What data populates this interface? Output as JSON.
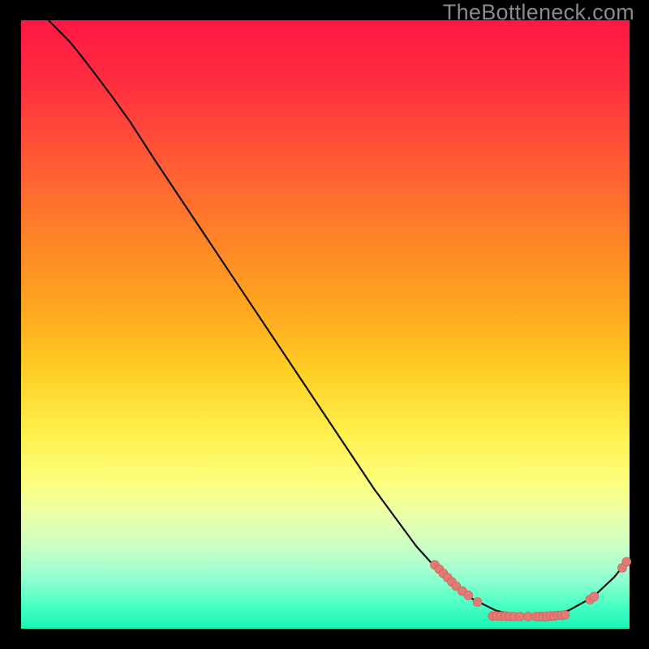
{
  "watermark": "TheBottleneck.com",
  "colors": {
    "curve": "#111111",
    "point_fill": "#e37a74",
    "point_stroke": "#c45d57"
  },
  "chart_data": {
    "type": "line",
    "title": "",
    "xlabel": "",
    "ylabel": "",
    "xlim": [
      0,
      100
    ],
    "ylim": [
      0,
      100
    ],
    "curve": [
      {
        "x": 4.5,
        "y": 100.0
      },
      {
        "x": 6.0,
        "y": 98.5
      },
      {
        "x": 8.0,
        "y": 96.5
      },
      {
        "x": 10.0,
        "y": 94.0
      },
      {
        "x": 12.0,
        "y": 91.4
      },
      {
        "x": 15.0,
        "y": 87.4
      },
      {
        "x": 18.0,
        "y": 83.2
      },
      {
        "x": 22.0,
        "y": 77.0
      },
      {
        "x": 28.0,
        "y": 68.0
      },
      {
        "x": 35.0,
        "y": 57.5
      },
      {
        "x": 42.0,
        "y": 47.0
      },
      {
        "x": 50.0,
        "y": 35.0
      },
      {
        "x": 58.0,
        "y": 23.0
      },
      {
        "x": 65.0,
        "y": 13.5
      },
      {
        "x": 70.0,
        "y": 8.0
      },
      {
        "x": 74.0,
        "y": 5.0
      },
      {
        "x": 78.0,
        "y": 3.0
      },
      {
        "x": 82.0,
        "y": 2.0
      },
      {
        "x": 86.0,
        "y": 2.0
      },
      {
        "x": 90.0,
        "y": 3.0
      },
      {
        "x": 94.0,
        "y": 5.2
      },
      {
        "x": 97.5,
        "y": 8.5
      },
      {
        "x": 99.5,
        "y": 11.0
      }
    ],
    "points": [
      {
        "x": 68.0,
        "y": 10.5
      },
      {
        "x": 68.7,
        "y": 9.8
      },
      {
        "x": 69.4,
        "y": 9.1
      },
      {
        "x": 70.1,
        "y": 8.4
      },
      {
        "x": 70.8,
        "y": 7.7
      },
      {
        "x": 71.5,
        "y": 7.0
      },
      {
        "x": 72.5,
        "y": 6.2
      },
      {
        "x": 73.5,
        "y": 5.5
      },
      {
        "x": 75.0,
        "y": 4.4
      },
      {
        "x": 77.5,
        "y": 2.1
      },
      {
        "x": 78.2,
        "y": 2.1
      },
      {
        "x": 78.9,
        "y": 2.1
      },
      {
        "x": 79.6,
        "y": 2.1
      },
      {
        "x": 80.3,
        "y": 2.0
      },
      {
        "x": 81.0,
        "y": 2.0
      },
      {
        "x": 82.0,
        "y": 2.0
      },
      {
        "x": 83.3,
        "y": 2.0
      },
      {
        "x": 84.6,
        "y": 2.0
      },
      {
        "x": 85.2,
        "y": 2.0
      },
      {
        "x": 85.8,
        "y": 2.0
      },
      {
        "x": 86.4,
        "y": 2.0
      },
      {
        "x": 87.0,
        "y": 2.1
      },
      {
        "x": 87.6,
        "y": 2.1
      },
      {
        "x": 88.2,
        "y": 2.2
      },
      {
        "x": 88.8,
        "y": 2.2
      },
      {
        "x": 89.4,
        "y": 2.3
      },
      {
        "x": 93.5,
        "y": 4.8
      },
      {
        "x": 94.2,
        "y": 5.3
      },
      {
        "x": 98.8,
        "y": 10.0
      },
      {
        "x": 99.5,
        "y": 11.0
      }
    ]
  }
}
